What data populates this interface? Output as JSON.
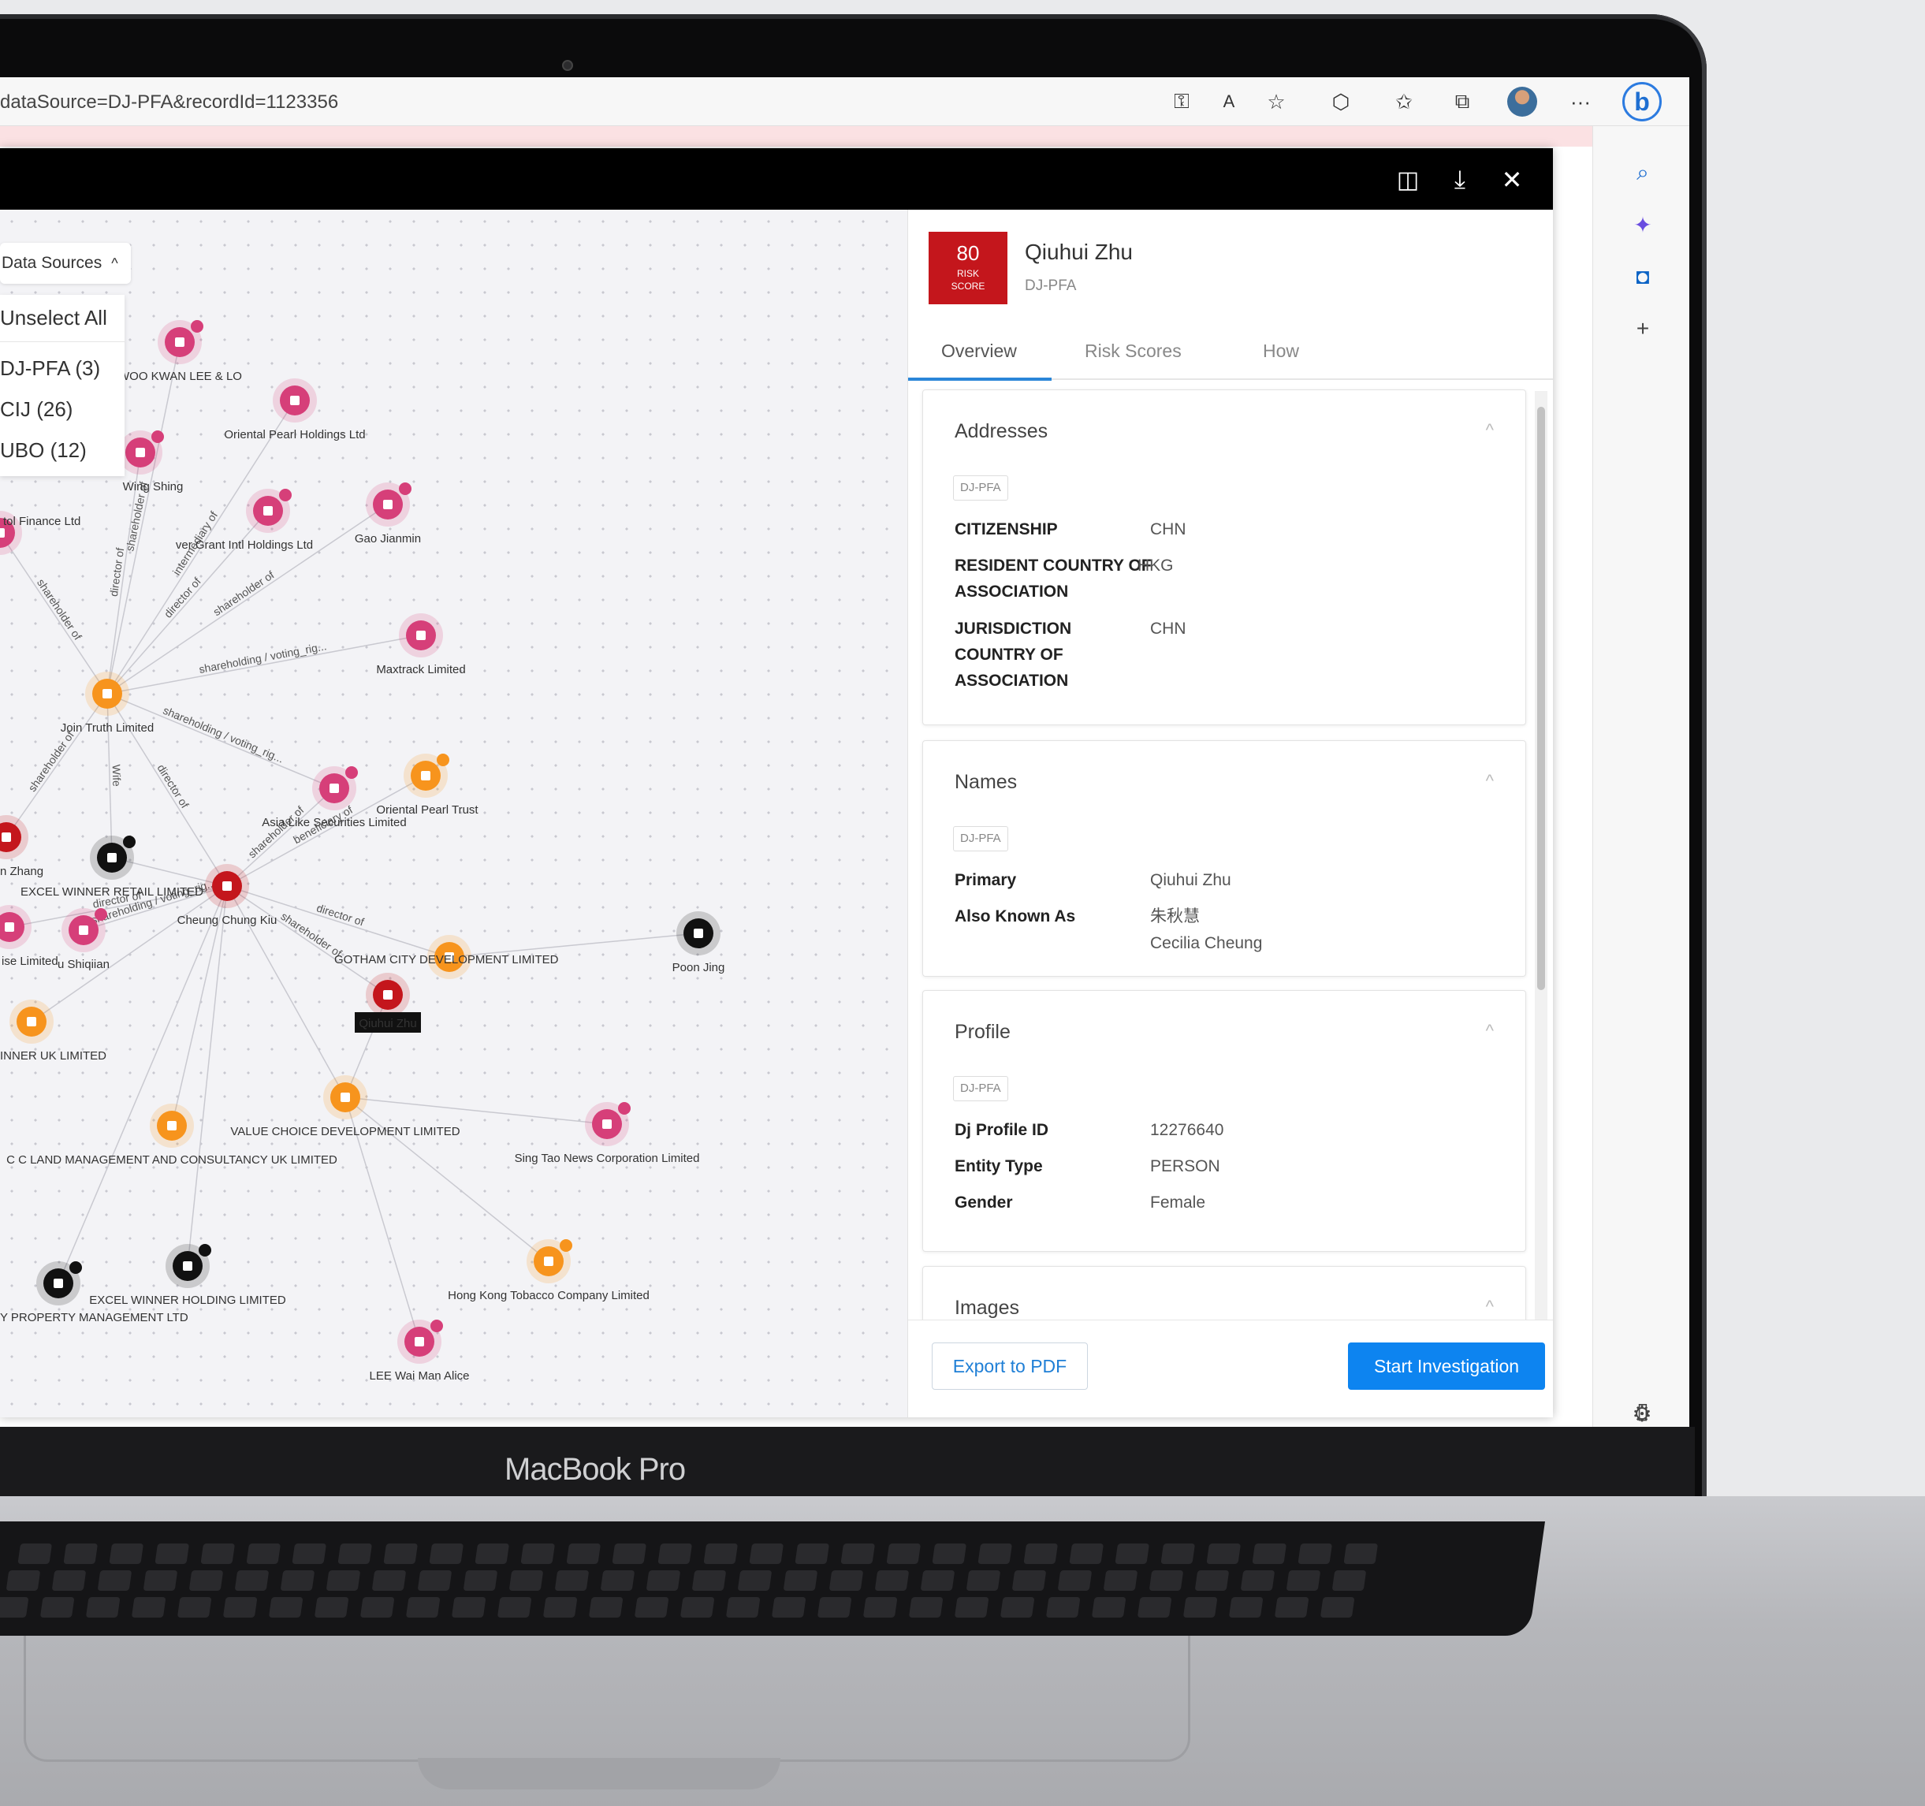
{
  "browser": {
    "url": "dataSource=DJ-PFA&recordId=1123356",
    "toolbar_icons": [
      "key-icon",
      "read-aloud-icon",
      "favorite-add-icon",
      "extensions-icon",
      "favorites-icon",
      "collections-icon",
      "profile-avatar",
      "more-icon"
    ],
    "more_label": "···",
    "bing_label": "b",
    "sidebar_icons": [
      "search-icon",
      "copilot-icon",
      "outlook-icon",
      "add-icon",
      "sidebar-toggle-icon",
      "settings-icon"
    ],
    "sidebar_plus": "+"
  },
  "laptop": {
    "brand": "MacBook Pro"
  },
  "modal": {
    "header_icons": [
      "split-view-icon",
      "download-icon",
      "close-icon"
    ],
    "close_glyph": "✕",
    "download_glyph": "⤓"
  },
  "graph": {
    "data_sources_label": "Data Sources",
    "chevron": "^",
    "unselect_all": "Unselect All",
    "sources": [
      "DJ-PFA (3)",
      "CIJ (26)",
      "UBO (12)"
    ],
    "nodes": [
      {
        "id": "wkl",
        "label": "WOO KWAN LEE & LO"
      },
      {
        "id": "opl",
        "label": "Oriental Pearl Holdings Ltd"
      },
      {
        "id": "ws",
        "label": "Wing Shing"
      },
      {
        "id": "tfl",
        "label": "tol Finance Ltd"
      },
      {
        "id": "gih",
        "label": "ver Grant Intl Holdings Ltd"
      },
      {
        "id": "gj",
        "label": "Gao Jianmin"
      },
      {
        "id": "ml",
        "label": "Maxtrack Limited"
      },
      {
        "id": "jtl",
        "label": "Join Truth Limited"
      },
      {
        "id": "opt",
        "label": "Oriental Pearl Trust"
      },
      {
        "id": "als",
        "label": "Asia Like Securities Limited"
      },
      {
        "id": "zh",
        "label": "n Zhang"
      },
      {
        "id": "ewr",
        "label": "EXCEL WINNER RETAIL LIMITED"
      },
      {
        "id": "cck",
        "label": "Cheung Chung Kiu"
      },
      {
        "id": "ise",
        "label": "ise Limited"
      },
      {
        "id": "us",
        "label": "u Shiqiian"
      },
      {
        "id": "pj",
        "label": "Poon Jing"
      },
      {
        "id": "gcd",
        "label": "GOTHAM CITY DEVELOPMENT LIMITED"
      },
      {
        "id": "qz",
        "label": "Qiuhui Zhu"
      },
      {
        "id": "wuk",
        "label": "INNER UK LIMITED"
      },
      {
        "id": "vcd",
        "label": "VALUE CHOICE DEVELOPMENT LIMITED"
      },
      {
        "id": "ccl",
        "label": "C C LAND MANAGEMENT AND CONSULTANCY UK LIMITED"
      },
      {
        "id": "stn",
        "label": "Sing Tao News Corporation Limited"
      },
      {
        "id": "ewh",
        "label": "EXCEL WINNER HOLDING LIMITED"
      },
      {
        "id": "ypm",
        "label": "Y PROPERTY MANAGEMENT LTD"
      },
      {
        "id": "hkt",
        "label": "Hong Kong Tobacco Company Limited"
      },
      {
        "id": "lwm",
        "label": "LEE Wai Man Alice"
      }
    ],
    "edge_labels": [
      "shareholder of",
      "director of",
      "shareholder of",
      "director of",
      "shareholder of",
      "shareholding / voting_rig...",
      "shareholding / voting_rig...",
      "Wife",
      "director of",
      "shareholder of",
      "intermediary of",
      "shareholder of",
      "director of",
      "shareholder of",
      "beneficiary of",
      "shareholding / voting_rig...",
      "director of"
    ]
  },
  "profile": {
    "risk_score": "80",
    "risk_label_1": "RISK",
    "risk_label_2": "SCORE",
    "name": "Qiuhui Zhu",
    "source": "DJ-PFA",
    "tabs": [
      "Overview",
      "Risk Scores",
      "How"
    ],
    "active_tab": "Overview",
    "addresses": {
      "title": "Addresses",
      "tag": "DJ-PFA",
      "rows": [
        {
          "k": "CITIZENSHIP",
          "v": "CHN"
        },
        {
          "k": "RESIDENT COUNTRY OF ASSOCIATION",
          "v": "HKG"
        },
        {
          "k": "JURISDICTION COUNTRY OF ASSOCIATION",
          "v": "CHN"
        }
      ]
    },
    "names": {
      "title": "Names",
      "tag": "DJ-PFA",
      "primary_k": "Primary",
      "primary_v": "Qiuhui Zhu",
      "aka_k": "Also Known As",
      "aka_v1": "朱秋慧",
      "aka_v2": "Cecilia Cheung"
    },
    "profile": {
      "title": "Profile",
      "tag": "DJ-PFA",
      "rows": [
        {
          "k": "Dj Profile ID",
          "v": "12276640"
        },
        {
          "k": "Entity Type",
          "v": "PERSON"
        },
        {
          "k": "Gender",
          "v": "Female"
        }
      ]
    },
    "images": {
      "title": "Images"
    },
    "chevron_up": "^",
    "export_label": "Export to PDF",
    "start_label": "Start Investigation"
  },
  "colors": {
    "risk_red": "#c4161c",
    "node_pink": "#d63f79",
    "node_orange": "#f7941d",
    "node_red": "#c4161c",
    "node_black": "#111111",
    "accent_blue": "#0d84f0"
  }
}
